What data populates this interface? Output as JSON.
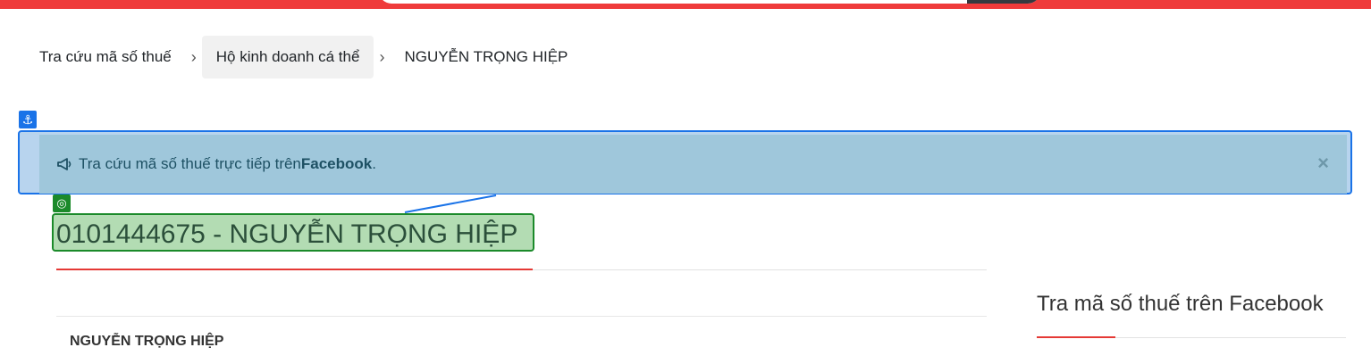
{
  "breadcrumb": {
    "items": [
      "Tra cứu mã số thuế",
      "Hộ kinh doanh cá thể",
      "NGUYỄN TRỌNG HIỆP"
    ],
    "separator": "›"
  },
  "alert": {
    "icon": "megaphone-icon",
    "text_prefix": "Tra cứu mã số thuế trực tiếp trên ",
    "text_bold": "Facebook",
    "text_suffix": ".",
    "close_label": "×",
    "background_color": "#9fc7db"
  },
  "annotations": {
    "anchor_icon": "⚓",
    "target_icon": "◎"
  },
  "page": {
    "title": "0101444675 - NGUYỄN TRỌNG HIỆP",
    "name_label": "NGUYỄN TRỌNG HIỆP"
  },
  "sidebar": {
    "title": "Tra mã số thuế trên Facebook"
  },
  "colors": {
    "accent_red": "#ef3b3b",
    "highlight_blue": "#1a73e8",
    "highlight_green": "#1b8a2a"
  }
}
